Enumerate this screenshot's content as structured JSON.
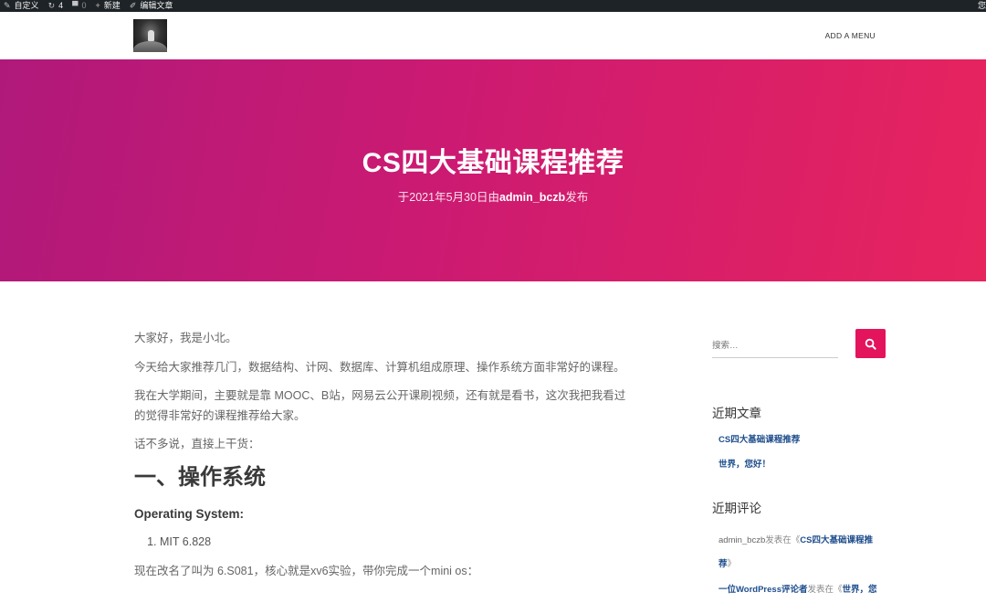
{
  "admin_bar": {
    "items": [
      {
        "icon": "brush-icon",
        "label": "自定义"
      },
      {
        "icon": "refresh-icon",
        "label": "4"
      },
      {
        "icon": "comment-icon",
        "label": "0"
      },
      {
        "icon": "plus-icon",
        "label": "新建"
      },
      {
        "icon": "pencil-icon",
        "label": "编辑文章"
      }
    ],
    "right_glyph": "您"
  },
  "header": {
    "menu_label": "ADD A MENU"
  },
  "hero": {
    "title": "CS四大基础课程推荐",
    "meta_prefix": "于2021年5月30日由",
    "author": "admin_bczb",
    "meta_suffix": "发布"
  },
  "article": {
    "paragraphs": [
      "大家好，我是小北。",
      "今天给大家推荐几门，数据结构、计网、数据库、计算机组成原理、操作系统方面非常好的课程。",
      "我在大学期间，主要就是靠 MOOC、B站，网易云公开课刷视频，还有就是看书，这次我把我看过的觉得非常好的课程推荐给大家。",
      "话不多说，直接上干货："
    ],
    "heading": "一、操作系统",
    "subheading": "Operating System:",
    "list": [
      "MIT 6.828"
    ],
    "cutoff_line": "现在改名了叫为 6.S081，核心就是xv6实验，带你完成一个mini os："
  },
  "sidebar": {
    "search_placeholder": "搜索…",
    "recent_posts_title": "近期文章",
    "recent_posts": [
      "CS四大基础课程推荐",
      "世界，您好！"
    ],
    "recent_comments_title": "近期评论",
    "comments": [
      {
        "author": "admin_bczb",
        "on": "发表在《",
        "post": "CS四大基础课程推荐",
        "close": "》"
      },
      {
        "author": "一位WordPress评论者",
        "on": "发表在《",
        "post": "世界，您好！",
        "close": "》"
      }
    ]
  },
  "colors": {
    "accent": "#e3145c",
    "hero_start": "#b0197a",
    "hero_end": "#e7245e",
    "admin_bar": "#1d2327",
    "link": "#1e4d8c"
  }
}
